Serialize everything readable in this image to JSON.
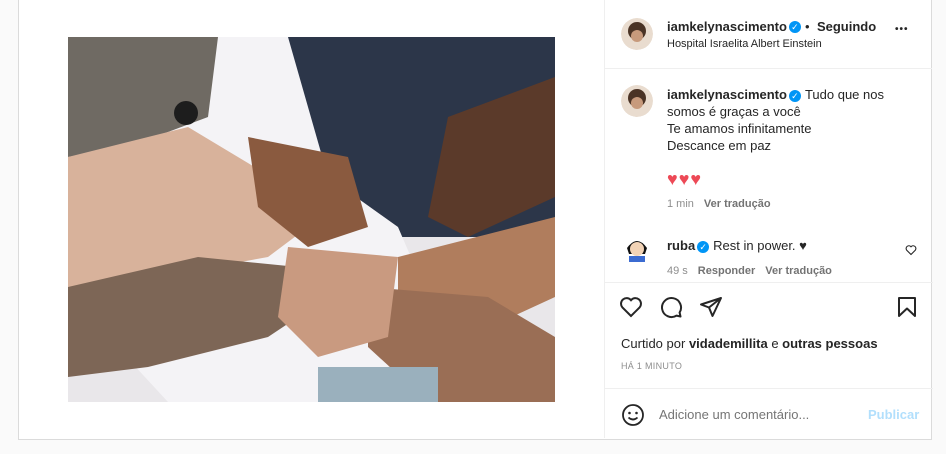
{
  "post": {
    "author": "iamkelynascimento",
    "dot": "•",
    "follow_status": "Seguindo",
    "location": "Hospital Israelita Albert Einstein",
    "more": "•••"
  },
  "caption": {
    "author": "iamkelynascimento",
    "line1": "Tudo que nos",
    "line2": "somos é graças a você",
    "line3": "Te amamos infinitamente",
    "line4": "Descance em paz",
    "hearts": "♥♥♥",
    "time": "1 min",
    "translate": "Ver tradução"
  },
  "comment": {
    "author": "ruba",
    "text": "Rest in power. ♥",
    "time": "49 s",
    "reply": "Responder",
    "translate": "Ver tradução"
  },
  "likes": {
    "prefix": "Curtido por",
    "user": "vidademillita",
    "conj": "e",
    "others": "outras pessoas"
  },
  "timestamp": "HÁ 1 MINUTO",
  "compose": {
    "placeholder": "Adicione um comentário...",
    "publish": "Publicar"
  },
  "colors": {
    "accent": "#0095f6",
    "publish_disabled": "#b2dffc",
    "heart_red": "#ed4956"
  }
}
